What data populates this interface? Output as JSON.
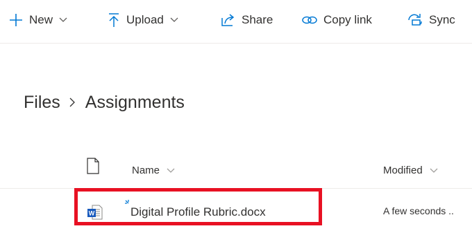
{
  "toolbar": {
    "new_label": "New",
    "upload_label": "Upload",
    "share_label": "Share",
    "copy_link_label": "Copy link",
    "sync_label": "Sync"
  },
  "breadcrumb": {
    "root": "Files",
    "current": "Assignments"
  },
  "list": {
    "columns": {
      "name": "Name",
      "modified": "Modified"
    },
    "rows": [
      {
        "name": "Digital Profile Rubric.docx",
        "modified": "A few seconds ..",
        "file_type": "word-document",
        "is_new": true,
        "highlighted": true
      }
    ]
  },
  "colors": {
    "accent": "#0078d4",
    "highlight": "#e81123",
    "word_blue": "#185abd",
    "text": "#323130"
  },
  "icons": [
    "plus-icon",
    "upload-icon",
    "share-icon",
    "link-icon",
    "sync-icon",
    "chevron-down-icon",
    "chevron-right-icon",
    "file-type-icon",
    "word-doc-icon",
    "new-item-icon"
  ]
}
